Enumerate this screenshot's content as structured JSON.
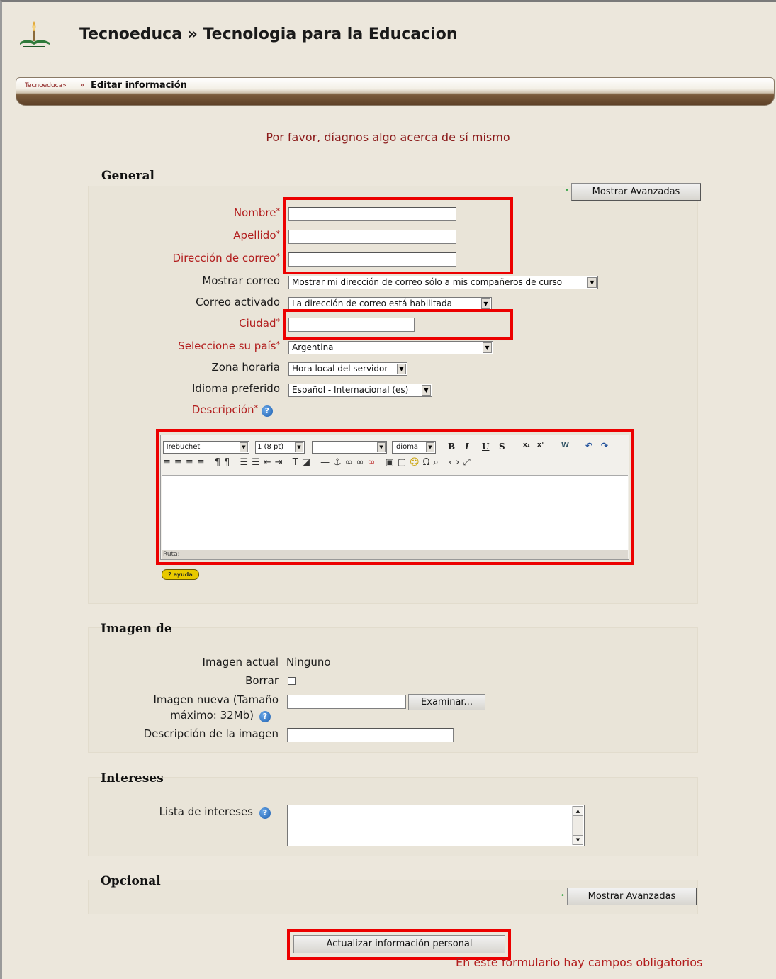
{
  "header": {
    "site_title": "Tecnoeduca » Tecnologia para la Educacion",
    "breadcrumb_link": "Tecnoeduca»",
    "breadcrumb_separator": "»",
    "breadcrumb_current": "Editar información"
  },
  "intro_text": "Por favor, díagnos algo acerca de sí mismo",
  "general": {
    "legend": "General",
    "show_advanced": "Mostrar Avanzadas",
    "fields": {
      "nombre": "Nombre",
      "apellido": "Apellido",
      "email": "Dirección de correo",
      "mostrar_correo": "Mostrar correo",
      "correo_activado": "Correo activado",
      "ciudad": "Ciudad",
      "pais": "Seleccione su país",
      "zona": "Zona horaria",
      "idioma": "Idioma preferido",
      "descripcion": "Descripción"
    },
    "required_marker": "*",
    "values": {
      "mostrar_correo": "Mostrar mi dirección de correo sólo a mis compañeros de curso",
      "correo_activado": "La dirección de correo está habilitada",
      "pais": "Argentina",
      "zona": "Hora local del servidor",
      "idioma": "Español - Internacional (es)"
    }
  },
  "editor": {
    "font": "Trebuchet",
    "size": "1 (8 pt)",
    "format": "",
    "lang": "Idioma",
    "bold": "B",
    "italic": "I",
    "underline": "U",
    "strike": "S",
    "path_label": "Ruta:",
    "help_badge": "? ayuda"
  },
  "imagen": {
    "legend": "Imagen de",
    "actual_label": "Imagen actual",
    "actual_value": "Ninguno",
    "borrar_label": "Borrar",
    "nueva_label_1": "Imagen nueva (Tamaño",
    "nueva_label_2": "máximo: 32Mb)",
    "examinar": "Examinar...",
    "desc_label": "Descripción de la imagen"
  },
  "intereses": {
    "legend": "Intereses",
    "lista_label": "Lista de intereses"
  },
  "opcional": {
    "legend": "Opcional",
    "show_advanced": "Mostrar Avanzadas"
  },
  "submit_label": "Actualizar información personal",
  "required_note": "En este formulario hay campos obligatorios",
  "colors": {
    "required_text": "#b21d1d",
    "highlight": "#ec0000",
    "page_bg": "#ece7dc"
  }
}
